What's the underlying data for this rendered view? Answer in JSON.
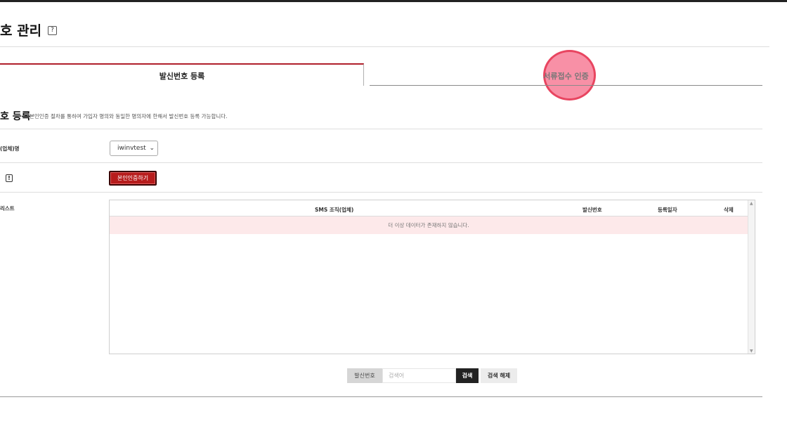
{
  "header": {
    "title": "호 관리",
    "help_icon": "question-box-icon",
    "help_glyph": "?"
  },
  "tabs": [
    {
      "label": "발신번호 등록",
      "active": true
    },
    {
      "label": "서류접수 인증",
      "active": false
    }
  ],
  "colors": {
    "accent": "#b0202b",
    "button": "#b71c1c",
    "empty_row_bg": "#fde9ea",
    "click_marker": "#f77892"
  },
  "section": {
    "title": "호 등록",
    "description": "본인인증 절차를 통하여 가입자 명의와 동일한 명의자에 한해서 발신번호 등록 가능합니다."
  },
  "form": {
    "org_label": "(업체)명",
    "org_selected": "iwinvtest",
    "warn_glyph": "!",
    "verify_button": "본인인증하기",
    "list_label": "리스트"
  },
  "table": {
    "columns": [
      "SMS 조직(업체)",
      "발신번호",
      "등록일자",
      "삭제"
    ],
    "empty_message": "더 이상 데이터가 존재하지 않습니다."
  },
  "search": {
    "field_label": "발신번호",
    "placeholder": "검색어",
    "search_button": "검색",
    "reset_button": "검색 해제"
  }
}
